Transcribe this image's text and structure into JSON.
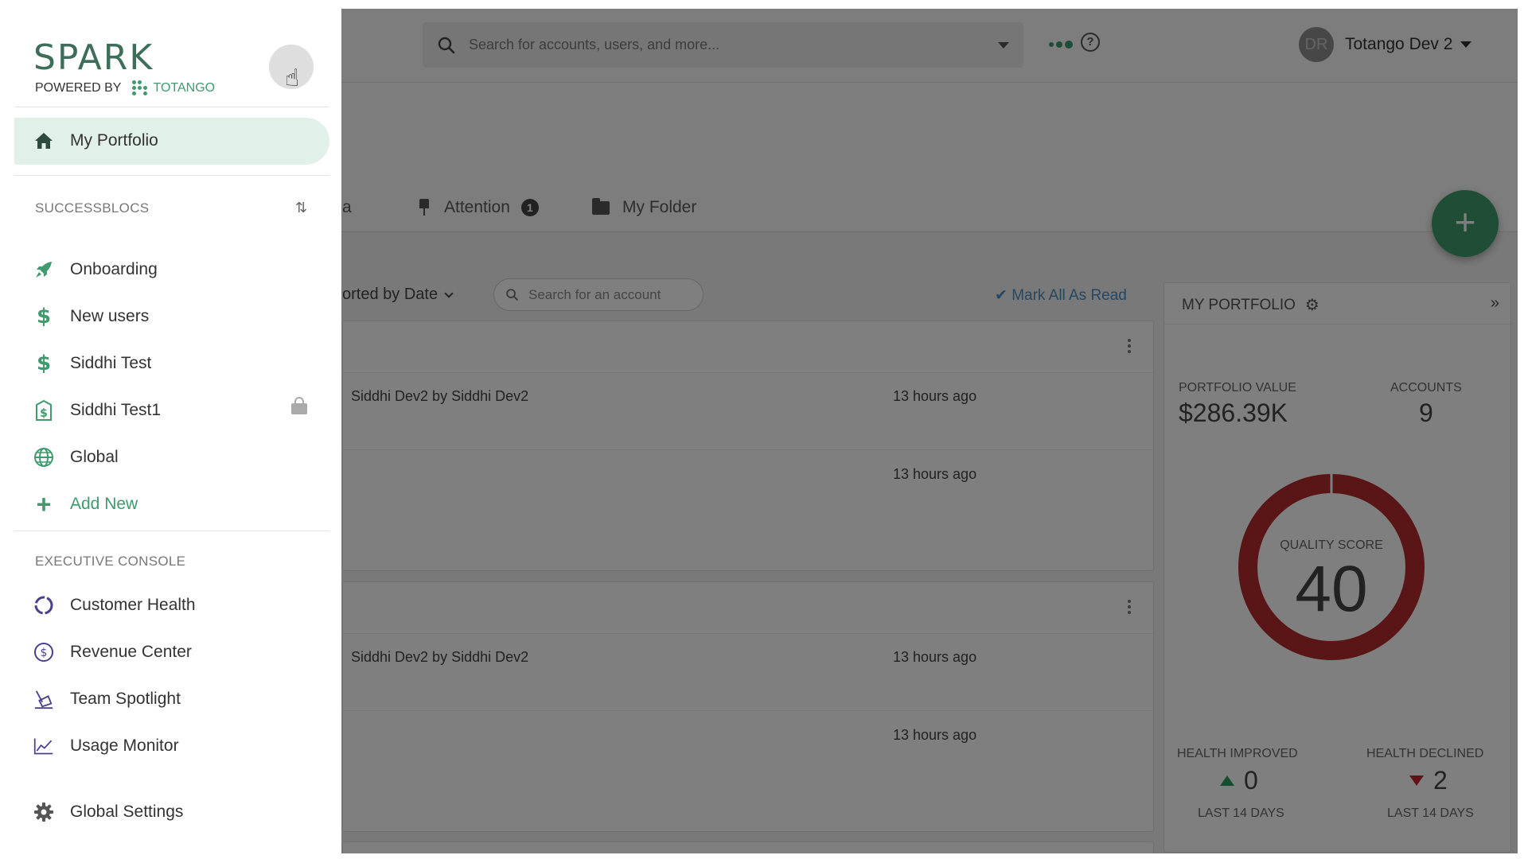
{
  "topbar": {
    "search_placeholder": "Search for accounts, users, and more...",
    "user_initials": "DR",
    "user_name": "Totango Dev 2"
  },
  "tabs": {
    "partial": "a",
    "attention": "Attention",
    "attention_count": "1",
    "my_folder": "My Folder"
  },
  "feed": {
    "sort_label": "orted by Date",
    "account_search_placeholder": "Search for an account",
    "mark_all_read": "Mark All As Read",
    "cards": [
      {
        "line": "Siddhi Dev2 by Siddhi Dev2",
        "time1": "13 hours ago",
        "time2": "13 hours ago"
      },
      {
        "line": "Siddhi Dev2 by Siddhi Dev2",
        "time1": "13 hours ago",
        "time2": "13 hours ago"
      }
    ]
  },
  "portfolio": {
    "title": "MY PORTFOLIO",
    "portfolio_value_label": "PORTFOLIO VALUE",
    "portfolio_value": "$286.39K",
    "accounts_label": "ACCOUNTS",
    "accounts": "9",
    "quality_score_label": "QUALITY SCORE",
    "quality_score": "40",
    "health_improved_label": "HEALTH IMPROVED",
    "health_improved": "0",
    "health_declined_label": "HEALTH DECLINED",
    "health_declined": "2",
    "period_label": "LAST 14 DAYS",
    "donut_color": "#b42a2f"
  },
  "sidebar": {
    "logo": "SPARK",
    "powered_by": "POWERED BY",
    "powered_brand": "TOTANGO",
    "active_item": "My Portfolio",
    "successblocs_label": "SUCCESSBLOCS",
    "successblocs": [
      {
        "label": "Onboarding",
        "icon": "rocket-icon"
      },
      {
        "label": "New users",
        "icon": "dollar-icon"
      },
      {
        "label": "Siddhi Test",
        "icon": "dollar-icon"
      },
      {
        "label": "Siddhi Test1",
        "icon": "dollar-tag-icon"
      },
      {
        "label": "Global",
        "icon": "globe-icon"
      }
    ],
    "add_new": "Add New",
    "executive_label": "EXECUTIVE CONSOLE",
    "executive": [
      {
        "label": "Customer Health",
        "icon": "health-ring-icon"
      },
      {
        "label": "Revenue Center",
        "icon": "dollar-circle-icon"
      },
      {
        "label": "Team Spotlight",
        "icon": "spotlight-icon"
      },
      {
        "label": "Usage Monitor",
        "icon": "line-chart-icon"
      }
    ],
    "global_settings": "Global Settings",
    "accent_color": "#3f9a6d"
  }
}
